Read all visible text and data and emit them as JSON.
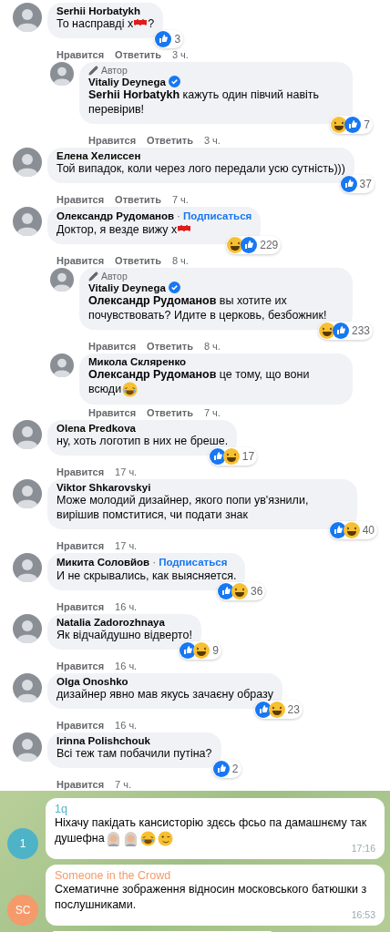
{
  "comments": [
    {
      "author": "Serhii Horbatykh",
      "text": "То насправді х",
      "censored": true,
      "text_after": "?",
      "actions": [
        "Нравится",
        "Ответить"
      ],
      "time": "3 ч.",
      "reactions": [
        {
          "kind": "like"
        }
      ],
      "count": "3",
      "replies": [
        {
          "badge": "Автор",
          "author": "Vitaliy Deynega",
          "verified": true,
          "mention": "Serhii Horbatykh",
          "text": " кажуть один півчий навіть перевірив!",
          "actions": [
            "Нравится",
            "Ответить"
          ],
          "time": "3 ч.",
          "reactions": [
            {
              "kind": "haha"
            },
            {
              "kind": "like"
            }
          ],
          "count": "7"
        }
      ]
    },
    {
      "author": "Елена Хелиссен",
      "text": "Той випадок, коли через лого передали усю сутність)))",
      "actions": [
        "Нравится",
        "Ответить"
      ],
      "time": "7 ч.",
      "reactions": [
        {
          "kind": "like"
        }
      ],
      "count": "37"
    },
    {
      "author": "Олександр Рудоманов",
      "separator": "·",
      "follow": "Подписаться",
      "text": "Доктор, я везде вижу х",
      "censored": true,
      "actions": [
        "Нравится",
        "Ответить"
      ],
      "time": "8 ч.",
      "reactions": [
        {
          "kind": "haha"
        },
        {
          "kind": "like"
        }
      ],
      "count": "229",
      "replies": [
        {
          "badge": "Автор",
          "author": "Vitaliy Deynega",
          "verified": true,
          "mention": "Олександр Рудоманов",
          "text": " вы хотите их почувствовать? Идите в церковь, безбожник!",
          "actions": [
            "Нравится",
            "Ответить"
          ],
          "time": "8 ч.",
          "reactions": [
            {
              "kind": "haha"
            },
            {
              "kind": "like"
            }
          ],
          "count": "233"
        },
        {
          "author": "Микола Скляренко",
          "mention": "Олександр Рудоманов",
          "text": " це тому, що вони всюди",
          "emoji": [
            {
              "kind": "laugh"
            }
          ],
          "actions": [
            "Нравится",
            "Ответить"
          ],
          "time": "7 ч."
        }
      ]
    },
    {
      "author": "Olena Predkova",
      "text": "ну, хоть логотип в них не бреше.",
      "actions": [
        "Нравится"
      ],
      "time": "17 ч.",
      "reactions": [
        {
          "kind": "like"
        },
        {
          "kind": "haha"
        }
      ],
      "count": "17"
    },
    {
      "author": "Viktor Shkarovskyi",
      "text": "Може молодий дизайнер, якого попи ув'язнили, вирішив помститися, чи подати знак",
      "actions": [
        "Нравится"
      ],
      "time": "17 ч.",
      "reactions": [
        {
          "kind": "like"
        },
        {
          "kind": "haha"
        }
      ],
      "count": "40"
    },
    {
      "author": "Микита Соловйов",
      "separator": "·",
      "follow": "Подписаться",
      "text": "И не скрывались, как выясняется.",
      "actions": [
        "Нравится"
      ],
      "time": "16 ч.",
      "reactions": [
        {
          "kind": "like"
        },
        {
          "kind": "haha"
        }
      ],
      "count": "36"
    },
    {
      "author": "Natalia Zadorozhnaya",
      "text": "Як відчайдушно відверто!",
      "actions": [
        "Нравится"
      ],
      "time": "16 ч.",
      "reactions": [
        {
          "kind": "like"
        },
        {
          "kind": "haha"
        }
      ],
      "count": "9"
    },
    {
      "author": "Olga Onoshko",
      "text": "дизайнер явно мав якусь зачаєну образу",
      "actions": [
        "Нравится"
      ],
      "time": "16 ч.",
      "reactions": [
        {
          "kind": "like"
        },
        {
          "kind": "haha"
        }
      ],
      "count": "23"
    },
    {
      "author": "Irinna Polishchouk",
      "text": "Всі теж там побачили путіна?",
      "actions": [
        "Нравится"
      ],
      "time": "7 ч.",
      "reactions": [
        {
          "kind": "like"
        }
      ],
      "count": "2"
    }
  ],
  "chat": {
    "messages": [
      {
        "initials": "1",
        "color": "#4fb3c8",
        "sender": "1q",
        "text": "Ніхачу пакідать кансисторію здєсь фсьо па дамашнєму так душефна",
        "emoji": [
          {
            "kind": "woman"
          },
          {
            "kind": "woman"
          },
          {
            "kind": "laugh"
          },
          {
            "kind": "wink"
          }
        ],
        "time": "17:16"
      },
      {
        "initials": "SC",
        "color": "#f59a6b",
        "sender": "Someone in the Crowd",
        "text": "Схематичне зображення відносин московського батюшки з послушниками.",
        "time": "16:53"
      }
    ]
  }
}
